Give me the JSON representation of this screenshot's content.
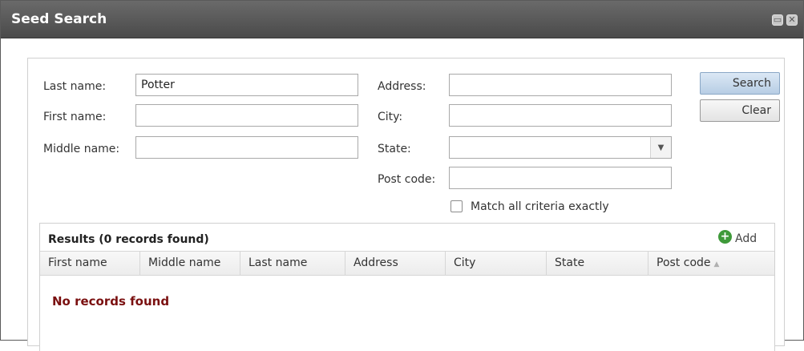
{
  "window": {
    "title": "Seed Search",
    "minimize_glyph": "▭",
    "close_glyph": "✕"
  },
  "form": {
    "last_name": {
      "label": "Last name:",
      "value": "Potter"
    },
    "first_name": {
      "label": "First name:",
      "value": ""
    },
    "middle_name": {
      "label": "Middle name:",
      "value": ""
    },
    "address": {
      "label": "Address:",
      "value": ""
    },
    "city": {
      "label": "City:",
      "value": ""
    },
    "state": {
      "label": "State:",
      "value": ""
    },
    "post_code": {
      "label": "Post code:",
      "value": ""
    },
    "match_all": {
      "label": "Match all criteria exactly",
      "checked": false
    }
  },
  "buttons": {
    "search": "Search",
    "clear": "Clear"
  },
  "results": {
    "title": "Results (0 records found)",
    "add_label": "Add",
    "columns": [
      "First name",
      "Middle name",
      "Last name",
      "Address",
      "City",
      "State",
      "Post code"
    ],
    "sort_column": "Post code",
    "sort_direction": "ascending",
    "empty_message": "No records found"
  },
  "colors": {
    "titlebar": "#555555",
    "empty_message": "#7a1010",
    "add_icon": "#3f9a3a"
  },
  "icons": {
    "add": "add-circle-icon",
    "sort": "sort-ascending-icon",
    "dropdown": "chevron-down-icon"
  }
}
